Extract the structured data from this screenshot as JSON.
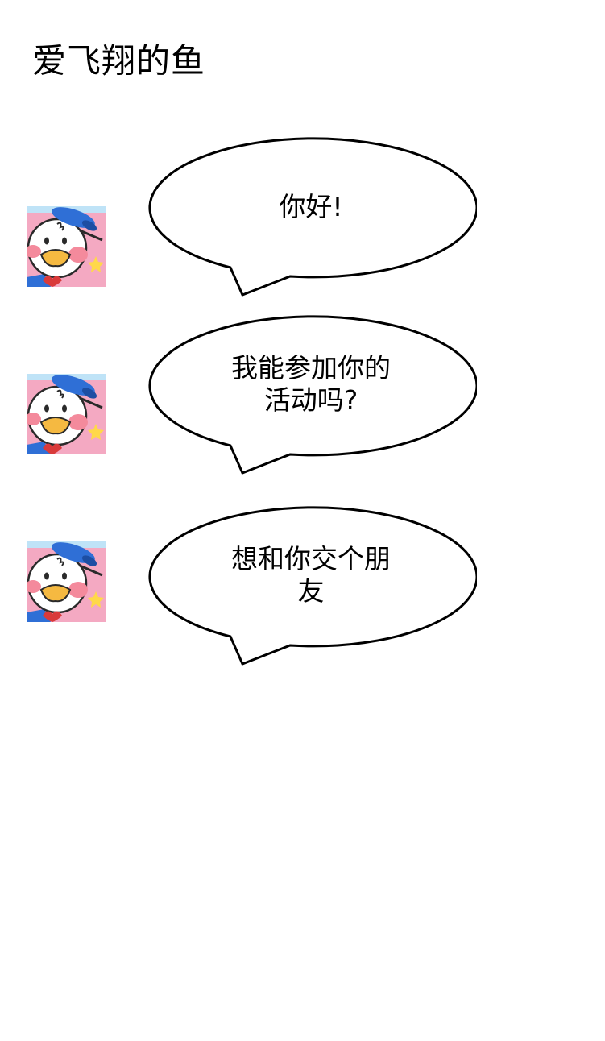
{
  "header": {
    "title": "爱飞翔的鱼"
  },
  "messages": [
    {
      "text": "你好!",
      "avatar_icon": "donald-duck-avatar"
    },
    {
      "text": "我能参加你的\n活动吗?",
      "avatar_icon": "donald-duck-avatar"
    },
    {
      "text": "想和你交个朋\n友",
      "avatar_icon": "donald-duck-avatar"
    }
  ],
  "colors": {
    "background": "#ffffff",
    "bubble_fill": "#ffffff",
    "bubble_stroke": "#000000",
    "avatar_bg": "#f4a9c2",
    "duck_face": "#ffffff",
    "duck_beak": "#f5b941",
    "duck_cheek": "#f48a9c",
    "duck_hat": "#2f6fd6",
    "star": "#ffd84a"
  }
}
